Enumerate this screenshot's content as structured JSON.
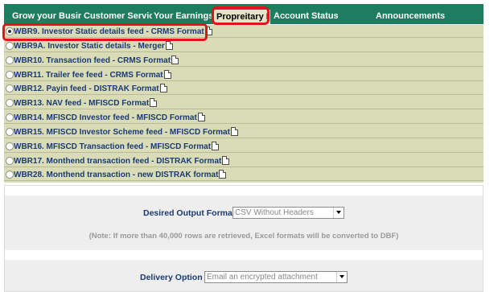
{
  "tabs": [
    {
      "label": "Grow your Busir",
      "active": false
    },
    {
      "label": "Customer Servic",
      "active": false
    },
    {
      "label": "Your Earnings",
      "active": false
    },
    {
      "label": "Propreitary I",
      "active": true
    },
    {
      "label": "Account Status",
      "active": false
    },
    {
      "label": "Announcements",
      "active": false
    }
  ],
  "reports": [
    {
      "label": "WBR9. Investor Static details feed - CRMS Format",
      "selected": true
    },
    {
      "label": "WBR9A. Investor Static details - Merger",
      "selected": false
    },
    {
      "label": "WBR10. Transaction feed - CRMS Format",
      "selected": false
    },
    {
      "label": "WBR11. Trailer fee feed - CRMS Format",
      "selected": false
    },
    {
      "label": "WBR12. Payin feed - DISTRAK Format",
      "selected": false
    },
    {
      "label": "WBR13. NAV feed - MFISCD Format",
      "selected": false
    },
    {
      "label": "WBR14. MFISCD Investor feed - MFISCD Format",
      "selected": false
    },
    {
      "label": "WBR15. MFISCD Investor Scheme feed - MFISCD Format",
      "selected": false
    },
    {
      "label": "WBR16. MFISCD Transaction feed - MFISCD Format",
      "selected": false
    },
    {
      "label": "WBR17. Monthend transaction feed - DISTRAK Format",
      "selected": false
    },
    {
      "label": "WBR28. Monthend transaction - new DISTRAK format",
      "selected": false
    }
  ],
  "output_format": {
    "label": "Desired Output Format",
    "value": "CSV Without Headers"
  },
  "note": "(Note: If more than 40,000 rows are retrieved, Excel formats will be converted to DBF)",
  "delivery": {
    "label": "Delivery Option",
    "value": "Email an encrypted attachment"
  },
  "colors": {
    "tab_bar": "#1f7d5f",
    "active_tab": "#e6e4c8",
    "report_rows": "#dadcb8",
    "link_text": "#1a3a73",
    "highlight": "#e0141a"
  }
}
